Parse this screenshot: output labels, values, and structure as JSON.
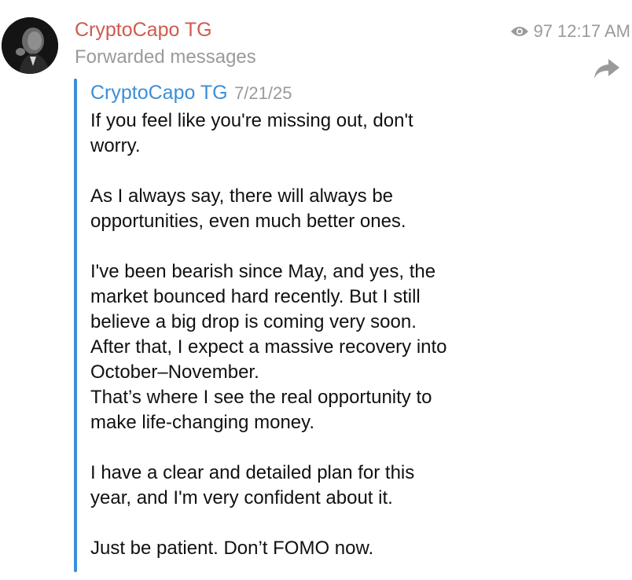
{
  "channel": {
    "name": "CryptoCapo TG",
    "forwarded_label": "Forwarded messages"
  },
  "meta": {
    "views": "97",
    "time": "12:17 AM"
  },
  "forwarded_from": {
    "author": "CryptoCapo TG",
    "date": "7/21/25"
  },
  "message": {
    "paragraphs": [
      "If you feel like you're missing out, don't\nworry.",
      "As I always say, there will always be\nopportunities, even much better ones.",
      "I've been bearish since May, and yes, the\nmarket bounced hard recently. But I still\nbelieve a big drop is coming very soon.\nAfter that, I expect a massive recovery into\nOctober–November.\nThat’s where I see the real opportunity to\nmake life-changing money.",
      "I have a clear and detailed plan for this\nyear, and I'm very confident about it.",
      "Just be patient. Don’t FOMO now."
    ]
  },
  "icons": {
    "views": "eye-icon",
    "share": "share-arrow-icon",
    "avatar": "avatar-portrait"
  },
  "colors": {
    "channel_name": "#cf5a4e",
    "accent_blue": "#3b8fd8",
    "muted": "#9a9a9a",
    "text": "#111111"
  }
}
